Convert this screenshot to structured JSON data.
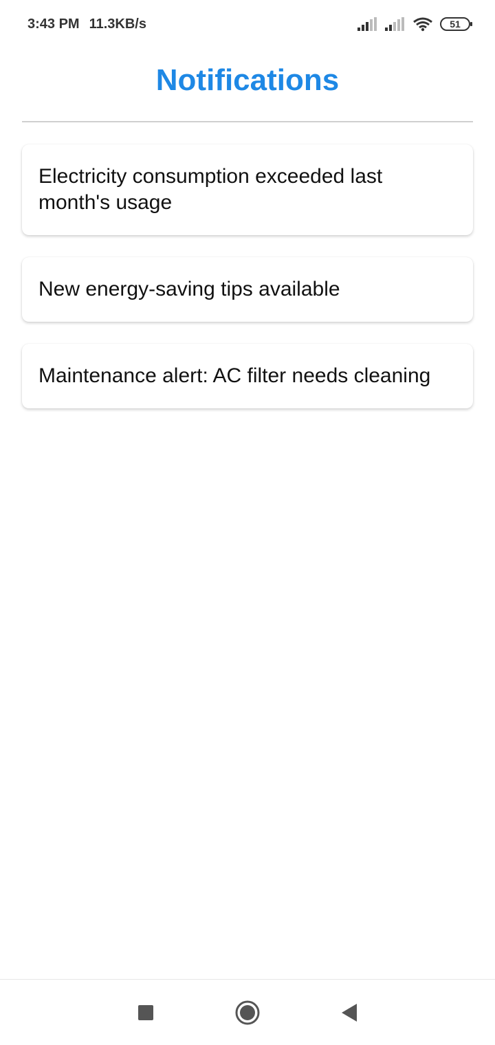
{
  "status_bar": {
    "time": "3:43 PM",
    "speed": "11.3KB/s",
    "battery": "51",
    "icons": [
      "signal-icon",
      "signal-icon",
      "wifi-icon",
      "battery-icon"
    ]
  },
  "header": {
    "title": "Notifications",
    "title_color": "#1E88E5"
  },
  "notifications": [
    {
      "text": "Electricity consumption exceeded last month's usage"
    },
    {
      "text": "New energy-saving tips available"
    },
    {
      "text": "Maintenance alert: AC filter needs cleaning"
    }
  ],
  "nav_bar": {
    "icons": [
      "recents-square-icon",
      "home-circle-icon",
      "back-triangle-icon"
    ]
  }
}
